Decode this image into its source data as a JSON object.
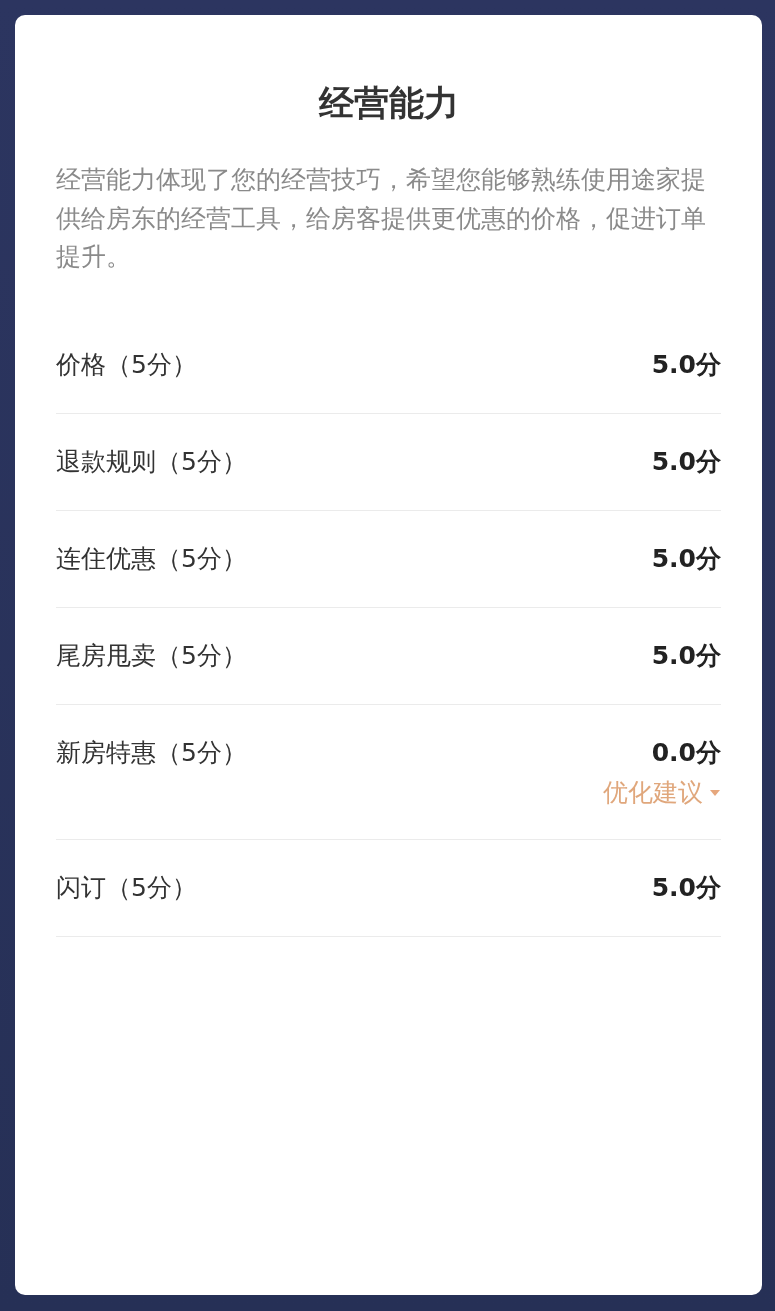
{
  "card": {
    "title": "经营能力",
    "description": "经营能力体现了您的经营技巧，希望您能够熟练使用途家提供给房东的经营工具，给房客提供更优惠的价格，促进订单提升。",
    "items": [
      {
        "label": "价格（5分）",
        "score": "5.0分"
      },
      {
        "label": "退款规则（5分）",
        "score": "5.0分"
      },
      {
        "label": "连住优惠（5分）",
        "score": "5.0分"
      },
      {
        "label": "尾房甩卖（5分）",
        "score": "5.0分"
      },
      {
        "label": "新房特惠（5分）",
        "score": "0.0分",
        "suggestion": "优化建议"
      },
      {
        "label": "闪订（5分）",
        "score": "5.0分"
      }
    ]
  }
}
